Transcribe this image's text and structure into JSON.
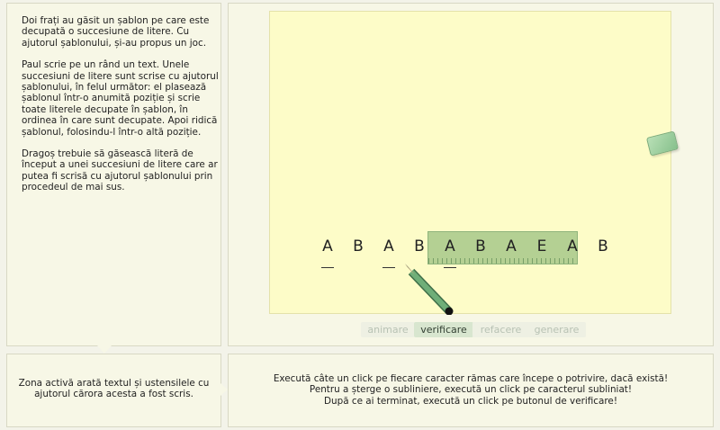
{
  "story": {
    "p1": "Doi frați au găsit un șablon pe care este decupată o succesiune de litere. Cu ajutorul șablonului, și-au propus un joc.",
    "p2": "Paul scrie pe un rând un text. Unele succesiuni de litere sunt scrise cu ajutorul șablonului, în felul următor: el plasează șablonul într-o anumită poziție și scrie toate literele decupate în șablon, în ordinea în care sunt decupate. Apoi ridică șablonul, folosindu-l într-o altă poziție.",
    "p3": "Dragoș trebuie să găsească  literă de început a unei succesiuni de litere care ar putea fi scrisă cu ajutorul șablonului prin procedeul de mai sus."
  },
  "letters": [
    "A",
    "B",
    "A",
    "B",
    "A",
    "B",
    "A",
    "E",
    "A",
    "B"
  ],
  "underlined": [
    0,
    2,
    4
  ],
  "template_letters": [
    "A",
    "B",
    "A",
    "B",
    "A"
  ],
  "buttons": {
    "animare": "animare",
    "verificare": "verificare",
    "refacere": "refacere",
    "generare": "generare"
  },
  "active_button": "verificare",
  "left_info": "Zona activă arată textul și ustensilele cu ajutorul cărora acesta a fost scris.",
  "instructions": {
    "line1": "Execută câte un click pe fiecare caracter rămas care începe o potrivire, dacă există!",
    "line2": "Pentru a șterge o subliniere, execută un click pe caracterul subliniat!",
    "line3": "După ce ai terminat, execută un click pe butonul de verificare!"
  },
  "colors": {
    "paper": "#fdfcc8",
    "template": "#87b473",
    "pencil": "#5b9c6a",
    "eraser": "#9fd0a0"
  }
}
